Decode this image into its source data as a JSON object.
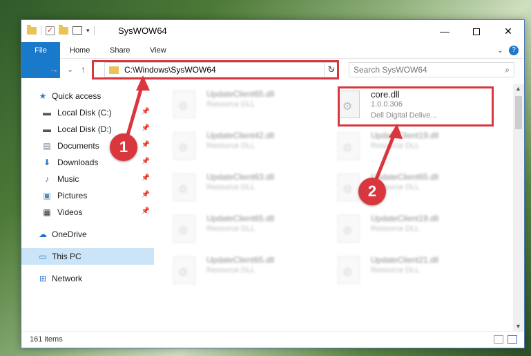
{
  "window": {
    "title": "SysWOW64",
    "controls": {
      "minimize": "—",
      "maximize": "",
      "close": "✕"
    }
  },
  "ribbon": {
    "tabs": [
      {
        "label": "File"
      },
      {
        "label": "Home"
      },
      {
        "label": "Share"
      },
      {
        "label": "View"
      }
    ],
    "help": "?"
  },
  "navigation": {
    "back": "←",
    "forward": "→",
    "recent": "⌄",
    "up": "↑",
    "address": "C:\\Windows\\SysWOW64",
    "refresh": "↻",
    "search_placeholder": "Search SysWOW64",
    "search_icon": "search-icon"
  },
  "sidebar": {
    "items": [
      {
        "label": "Quick access",
        "icon": "star-icon"
      },
      {
        "label": "Local Disk (C:)",
        "icon": "drive-icon",
        "pinned": true
      },
      {
        "label": "Local Disk (D:)",
        "icon": "drive-icon",
        "pinned": true
      },
      {
        "label": "Documents",
        "icon": "documents-icon",
        "pinned": true
      },
      {
        "label": "Downloads",
        "icon": "downloads-icon",
        "pinned": true
      },
      {
        "label": "Music",
        "icon": "music-icon",
        "pinned": true
      },
      {
        "label": "Pictures",
        "icon": "pictures-icon",
        "pinned": true
      },
      {
        "label": "Videos",
        "icon": "videos-icon",
        "pinned": true
      },
      {
        "label": "OneDrive",
        "icon": "cloud-icon"
      },
      {
        "label": "This PC",
        "icon": "computer-icon",
        "selected": true
      },
      {
        "label": "Network",
        "icon": "network-icon"
      }
    ]
  },
  "files": [
    {
      "name": "UpdateClient65.dll",
      "desc": "Resource DLL"
    },
    {
      "name": "core.dll",
      "version": "1.0.0.306",
      "desc": "Dell Digital Delive..."
    },
    {
      "name": "UpdateClient42.dll",
      "desc": "Resource DLL"
    },
    {
      "name": "UpdateClient19.dll",
      "desc": "Resource DLL"
    },
    {
      "name": "UpdateClient63.dll",
      "desc": "Resource DLL"
    },
    {
      "name": "UpdateClient65.dll",
      "desc": "Resource DLL"
    },
    {
      "name": "UpdateClient65.dll",
      "desc": "Resource DLL"
    },
    {
      "name": "UpdateClient19.dll",
      "desc": "Resource DLL"
    },
    {
      "name": "UpdateClient65.dll",
      "desc": "Resource DLL"
    },
    {
      "name": "UpdateClient21.dll",
      "desc": "Resource DLL"
    }
  ],
  "status": {
    "count": "161 items"
  },
  "annotations": [
    {
      "label": "1"
    },
    {
      "label": "2"
    }
  ],
  "colors": {
    "accent": "#1979ca",
    "highlight": "#d9363e",
    "selection": "#cce4f7"
  }
}
